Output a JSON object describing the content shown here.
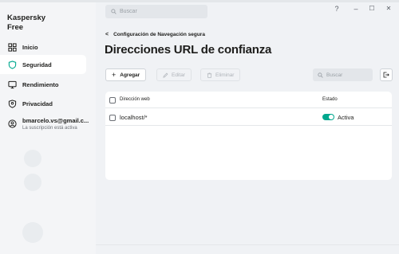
{
  "app": {
    "name_line1": "Kaspersky",
    "name_line2": "Free"
  },
  "sidebar": {
    "items": [
      {
        "label": "Inicio",
        "icon": "grid-icon"
      },
      {
        "label": "Seguridad",
        "icon": "shield-icon",
        "active": true
      },
      {
        "label": "Rendimiento",
        "icon": "monitor-icon"
      },
      {
        "label": "Privacidad",
        "icon": "privacy-icon"
      }
    ],
    "account": {
      "name": "bmarcelo.vs@gmail.c...",
      "subtitle": "La suscripción está activa"
    }
  },
  "topbar": {
    "search_placeholder": "Buscar",
    "help": "?",
    "minimize": "–",
    "maximize": "☐",
    "close": "✕"
  },
  "breadcrumb": {
    "back": "<",
    "label": "Configuración de Navegación segura"
  },
  "page_title": "Direcciones URL de confianza",
  "toolbar": {
    "add_label": "Agregar",
    "edit_label": "Editar",
    "delete_label": "Eliminar",
    "search_placeholder": "Buscar"
  },
  "table": {
    "headers": {
      "url": "Dirección web",
      "state": "Estado"
    },
    "rows": [
      {
        "url": "localhost/*",
        "state": "Activa",
        "enabled": true
      }
    ]
  },
  "colors": {
    "accent": "#00a88e",
    "background": "#f0f2f5",
    "panel": "#ffffff"
  }
}
